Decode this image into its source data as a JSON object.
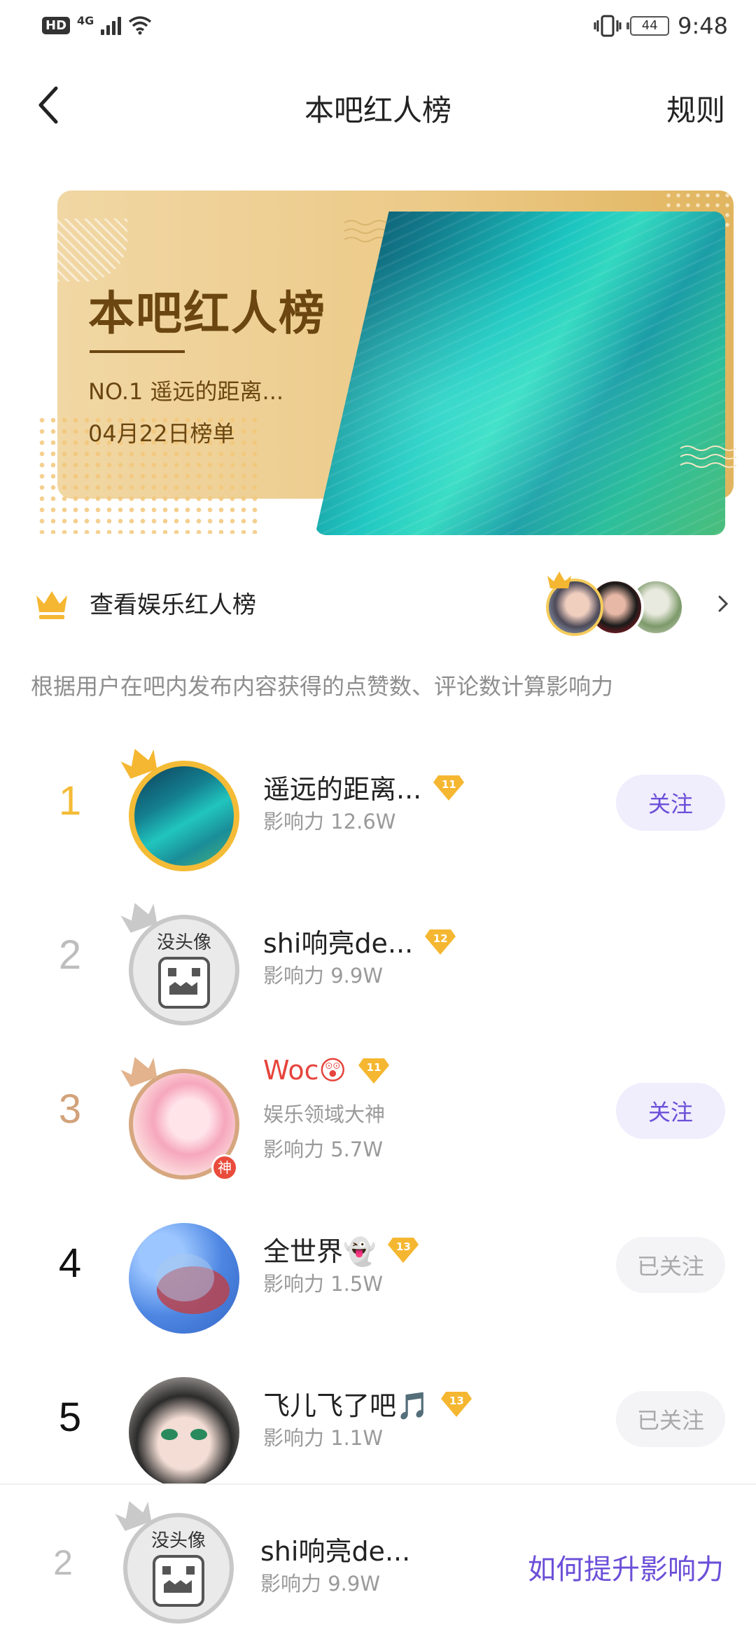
{
  "status_bar": {
    "hd": "HD",
    "network": "4G",
    "battery": "44",
    "time": "9:48"
  },
  "nav": {
    "title": "本吧红人榜",
    "rules": "规则"
  },
  "banner": {
    "title": "本吧红人榜",
    "no1": "NO.1  遥远的距离...",
    "date": "04月22日榜单",
    "colors": {
      "gold": "#ecca88",
      "text": "#6b4610"
    }
  },
  "entertainment": {
    "label": "查看娱乐红人榜"
  },
  "description": "根据用户在吧内发布内容获得的点赞数、评论数计算影响力",
  "ranking": [
    {
      "rank": "1",
      "rank_color": "#f4bb36",
      "name": "遥远的距离...",
      "name_red": false,
      "level": "11",
      "title": "",
      "influence": "影响力  12.6W",
      "button": "关注",
      "button_state": "active",
      "crown": "gold-crown-icon"
    },
    {
      "rank": "2",
      "rank_color": "#bdbdbd",
      "name": "shi响亮de...",
      "name_red": false,
      "level": "12",
      "title": "",
      "influence": "影响力  9.9W",
      "button": "",
      "button_state": "none",
      "crown": "silver-crown-icon"
    },
    {
      "rank": "3",
      "rank_color": "#d2a27a",
      "name": "Woc😲",
      "name_red": true,
      "level": "11",
      "title": "娱乐领域大神",
      "influence": "影响力  5.7W",
      "button": "关注",
      "button_state": "active",
      "crown": "bronze-crown-icon",
      "badge": "神"
    },
    {
      "rank": "4",
      "rank_color": "#111111",
      "name": "全世界👻",
      "name_red": false,
      "level": "13",
      "title": "",
      "influence": "影响力  1.5W",
      "button": "已关注",
      "button_state": "done",
      "crown": ""
    },
    {
      "rank": "5",
      "rank_color": "#111111",
      "name": "飞儿飞了吧🎵",
      "name_red": false,
      "level": "13",
      "title": "",
      "influence": "影响力  1.1W",
      "button": "已关注",
      "button_state": "done",
      "crown": ""
    }
  ],
  "bottom_bar": {
    "rank": "2",
    "name": "shi响亮de...",
    "influence": "影响力  9.9W",
    "action": "如何提升影响力"
  },
  "avatar_texts": {
    "no_avatar": "没头像"
  },
  "accent": "#6b4fd8"
}
